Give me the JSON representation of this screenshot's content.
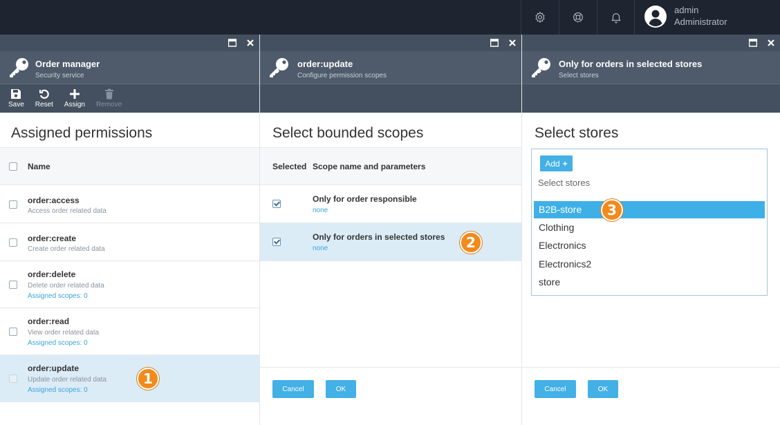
{
  "topbar": {
    "icons": [
      "gear-icon",
      "lifebuoy-icon",
      "bell-icon"
    ],
    "user": {
      "name": "admin",
      "role": "Administrator"
    }
  },
  "blade1": {
    "title": "Order manager",
    "subtitle": "Security service",
    "toolbar": {
      "save": "Save",
      "reset": "Reset",
      "assign": "Assign",
      "remove": "Remove"
    },
    "heading": "Assigned permissions",
    "column_name": "Name",
    "rows": [
      {
        "name": "order:access",
        "desc": "Access order related data",
        "scopes": ""
      },
      {
        "name": "order:create",
        "desc": "Create order related data",
        "scopes": ""
      },
      {
        "name": "order:delete",
        "desc": "Delete order related data",
        "scopes": "Assigned scopes: 0"
      },
      {
        "name": "order:read",
        "desc": "View order related data",
        "scopes": "Assigned scopes: 0"
      },
      {
        "name": "order:update",
        "desc": "Update order related data",
        "scopes": "Assigned scopes: 0"
      }
    ],
    "badge": "1"
  },
  "blade2": {
    "title": "order:update",
    "subtitle": "Configure permission scopes",
    "heading": "Select bounded scopes",
    "col_selected": "Selected",
    "col_name": "Scope name and parameters",
    "rows": [
      {
        "name": "Only for order responsible",
        "param": "none"
      },
      {
        "name": "Only for orders in selected stores",
        "param": "none"
      }
    ],
    "cancel": "Cancel",
    "ok": "OK",
    "badge": "2"
  },
  "blade3": {
    "title": "Only for orders in selected stores",
    "subtitle": "Select stores",
    "heading": "Select stores",
    "add": "Add",
    "placeholder": "Select stores",
    "stores": [
      "B2B-store",
      "Clothing",
      "Electronics",
      "Electronics2",
      "store"
    ],
    "cancel": "Cancel",
    "ok": "OK",
    "badge": "3"
  },
  "colors": {
    "accent": "#43b0e6",
    "header": "#4f5b6b",
    "topbar": "#1e2430",
    "selected_row": "#dbecf7",
    "badge": "#f28a1c"
  }
}
